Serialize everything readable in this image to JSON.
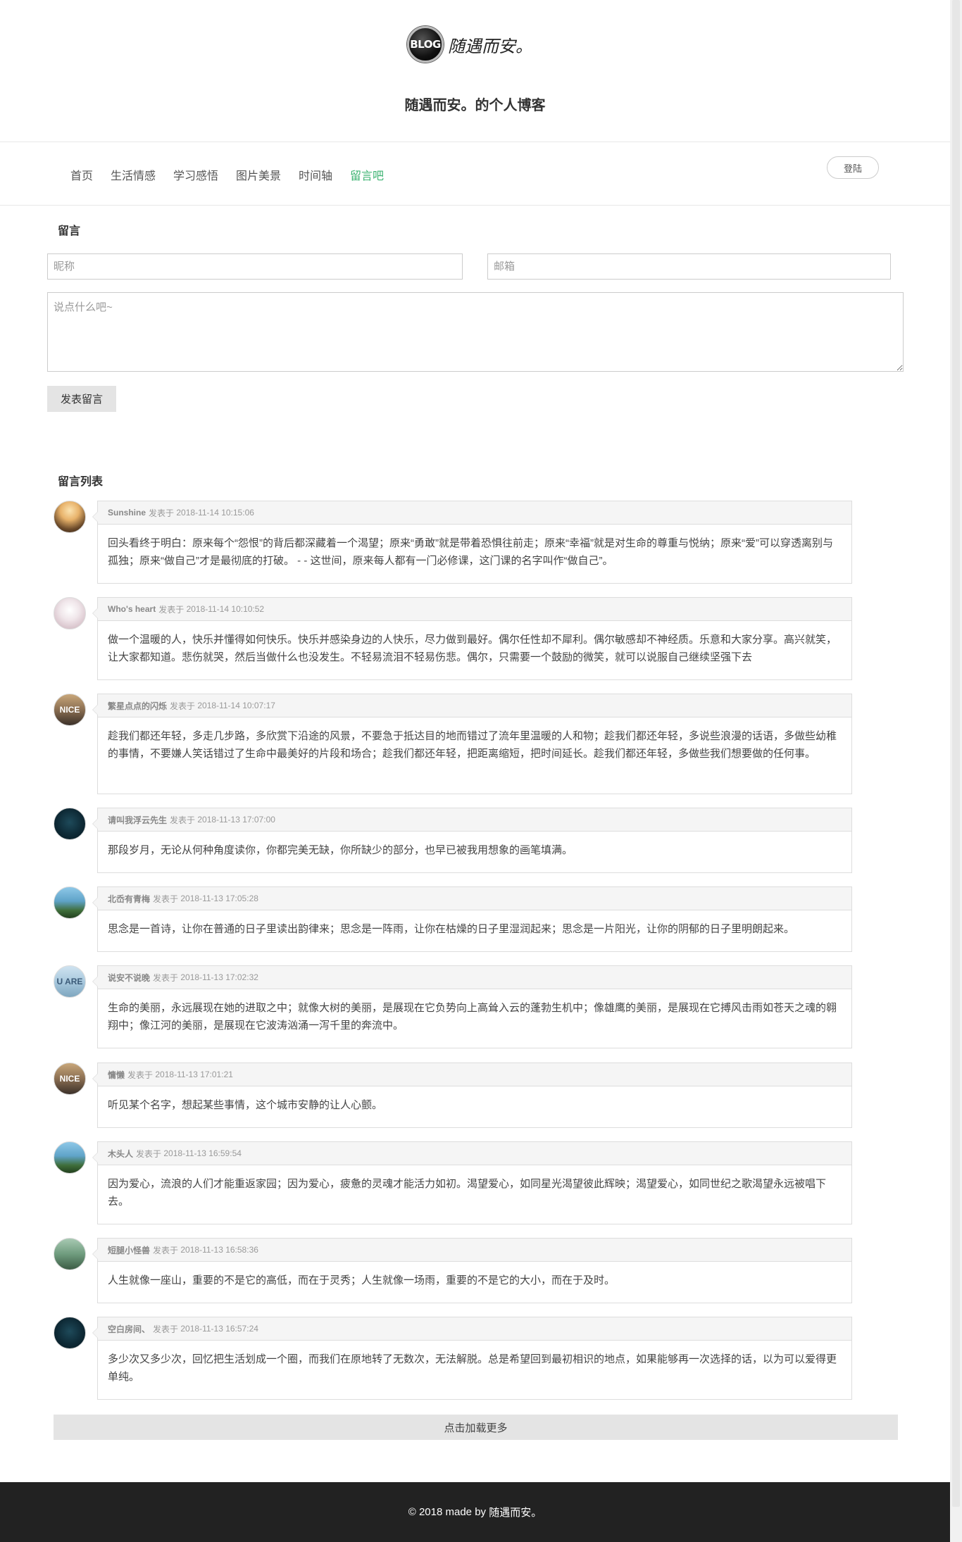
{
  "brand": {
    "logo_badge": "BLOG",
    "logo_text": "随遇而安。",
    "site_title": "随遇而安。的个人博客"
  },
  "nav": {
    "items": [
      {
        "label": "首页"
      },
      {
        "label": "生活情感"
      },
      {
        "label": "学习感悟"
      },
      {
        "label": "图片美景"
      },
      {
        "label": "时间轴"
      },
      {
        "label": "留言吧"
      }
    ],
    "active_index": 5,
    "active_color": "#3cb371",
    "login_label": "登陆"
  },
  "form": {
    "title": "留言",
    "nickname_placeholder": "昵称",
    "email_placeholder": "邮箱",
    "message_placeholder": "说点什么吧~",
    "submit_label": "发表留言"
  },
  "list": {
    "title": "留言列表",
    "posted_prefix": "发表于",
    "comments": [
      {
        "name": "Sunshine",
        "time": "2018-11-14 10:15:06",
        "avatar": "sunset-avatar-icon",
        "text": "回头看终于明白：原来每个“怨恨”的背后都深藏着一个渴望；原来“勇敢”就是带着恐惧往前走；原来“幸福”就是对生命的尊重与悦纳；原来“爱”可以穿透离别与孤独；原来“做自己”才是最彻底的打破。 - - 这世间，原来每人都有一门必修课，这门课的名字叫作“做自己”。"
      },
      {
        "name": "Who's heart",
        "time": "2018-11-14 10:10:52",
        "avatar": "cloud-avatar-icon",
        "text": "做一个温暖的人，快乐并懂得如何快乐。快乐并感染身边的人快乐，尽力做到最好。偶尔任性却不犀利。偶尔敏感却不神经质。乐意和大家分享。高兴就笑，让大家都知道。悲伤就哭，然后当做什么也没发生。不轻易流泪不轻易伤悲。偶尔，只需要一个鼓励的微笑，就可以说服自己继续坚强下去"
      },
      {
        "name": "繁星点点的闪烁",
        "time": "2018-11-14 10:07:17",
        "avatar": "nice-avatar-icon",
        "text": "趁我们都还年轻，多走几步路，多欣赏下沿途的风景，不要急于抵达目的地而错过了流年里温暖的人和物；趁我们都还年轻，多说些浪漫的话语，多做些幼稚的事情，不要嫌人笑话错过了生命中最美好的片段和场合；趁我们都还年轻，把距离缩短，把时间延长。趁我们都还年轻，多做些我们想要做的任何事。"
      },
      {
        "name": "请叫我浮云先生",
        "time": "2018-11-13 17:07:00",
        "avatar": "night-avatar-icon",
        "text": "那段岁月，无论从何种角度读你，你都完美无缺，你所缺少的部分，也早已被我用想象的画笔填满。"
      },
      {
        "name": "北岙有青梅",
        "time": "2018-11-13 17:05:28",
        "avatar": "tree-avatar-icon",
        "text": "思念是一首诗，让你在普通的日子里读出韵律来；思念是一阵雨，让你在枯燥的日子里湿润起来；思念是一片阳光，让你的阴郁的日子里明朗起来。"
      },
      {
        "name": "说安不说晚",
        "time": "2018-11-13 17:02:32",
        "avatar": "uare-avatar-icon",
        "text": "生命的美丽，永远展现在她的进取之中；就像大树的美丽，是展现在它负势向上高耸入云的蓬勃生机中；像雄鹰的美丽，是展现在它搏风击雨如苍天之魂的翱翔中；像江河的美丽，是展现在它波涛汹涌一泻千里的奔流中。"
      },
      {
        "name": "慵懒",
        "time": "2018-11-13 17:01:21",
        "avatar": "nice-avatar-icon",
        "text": "听见某个名字，想起某些事情，这个城市安静的让人心颤。"
      },
      {
        "name": "木头人",
        "time": "2018-11-13 16:59:54",
        "avatar": "tree-avatar-icon",
        "text": "因为爱心，流浪的人们才能重返家园；因为爱心，疲惫的灵魂才能活力如初。渴望爱心，如同星光渴望彼此辉映；渴望爱心，如同世纪之歌渴望永远被唱下去。"
      },
      {
        "name": "短腿小怪兽",
        "time": "2018-11-13 16:58:36",
        "avatar": "field-avatar-icon",
        "text": "人生就像一座山，重要的不是它的高低，而在于灵秀；人生就像一场雨，重要的不是它的大小，而在于及时。"
      },
      {
        "name": "空白房间、",
        "time": "2018-11-13 16:57:24",
        "avatar": "night-avatar-icon",
        "text": "多少次又多少次，回忆把生活划成一个圈，而我们在原地转了无数次，无法解脱。总是希望回到最初相识的地点，如果能够再一次选择的话，以为可以爱得更单纯。"
      }
    ],
    "load_more_label": "点击加载更多"
  },
  "footer": {
    "text": "© 2018 made by",
    "author": "随遇而安。"
  }
}
